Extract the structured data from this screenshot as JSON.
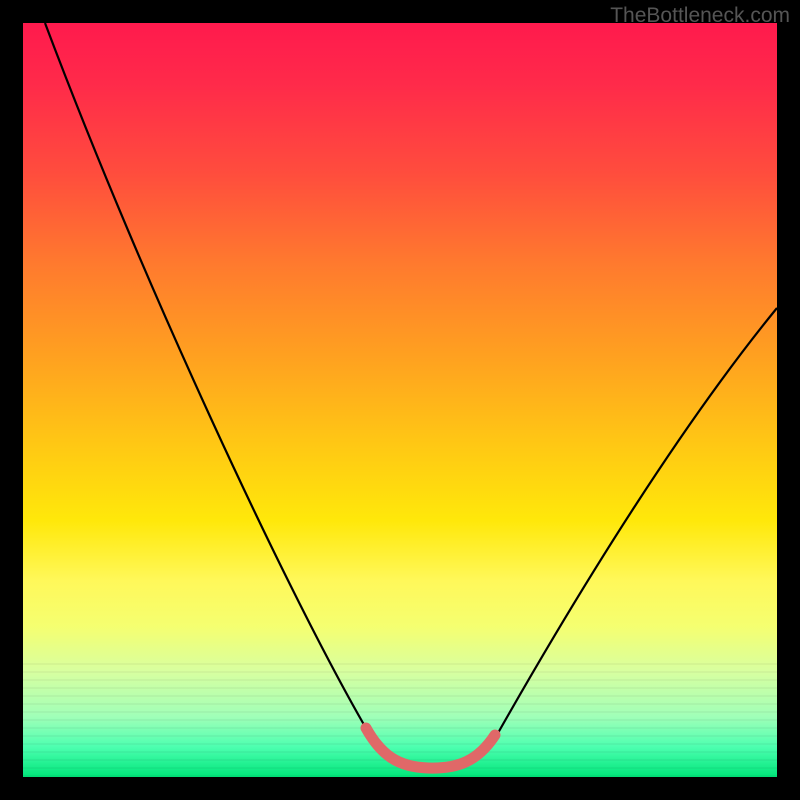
{
  "watermark": "TheBottleneck.com",
  "chart_data": {
    "type": "line",
    "title": "",
    "xlabel": "",
    "ylabel": "",
    "xlim": [
      0,
      100
    ],
    "ylim": [
      0,
      100
    ],
    "series": [
      {
        "name": "curve",
        "x": [
          3,
          10,
          20,
          30,
          40,
          45,
          50,
          55,
          58,
          62,
          65,
          70,
          80,
          90,
          100
        ],
        "values": [
          100,
          82,
          57,
          33,
          12,
          5,
          2,
          1,
          1,
          2,
          5,
          12,
          30,
          48,
          62
        ]
      },
      {
        "name": "highlighted-minimum",
        "x": [
          45,
          48,
          51,
          54,
          57,
          60,
          62
        ],
        "values": [
          5,
          3,
          2,
          1.5,
          1.5,
          2.5,
          4
        ]
      }
    ],
    "gradient_colors": {
      "top": "#ff1a4d",
      "mid_upper": "#ff9a20",
      "mid": "#ffe80a",
      "mid_lower": "#f5ff70",
      "bottom": "#00e67a"
    },
    "highlight_color": "#e06868",
    "curve_color": "#000000"
  }
}
